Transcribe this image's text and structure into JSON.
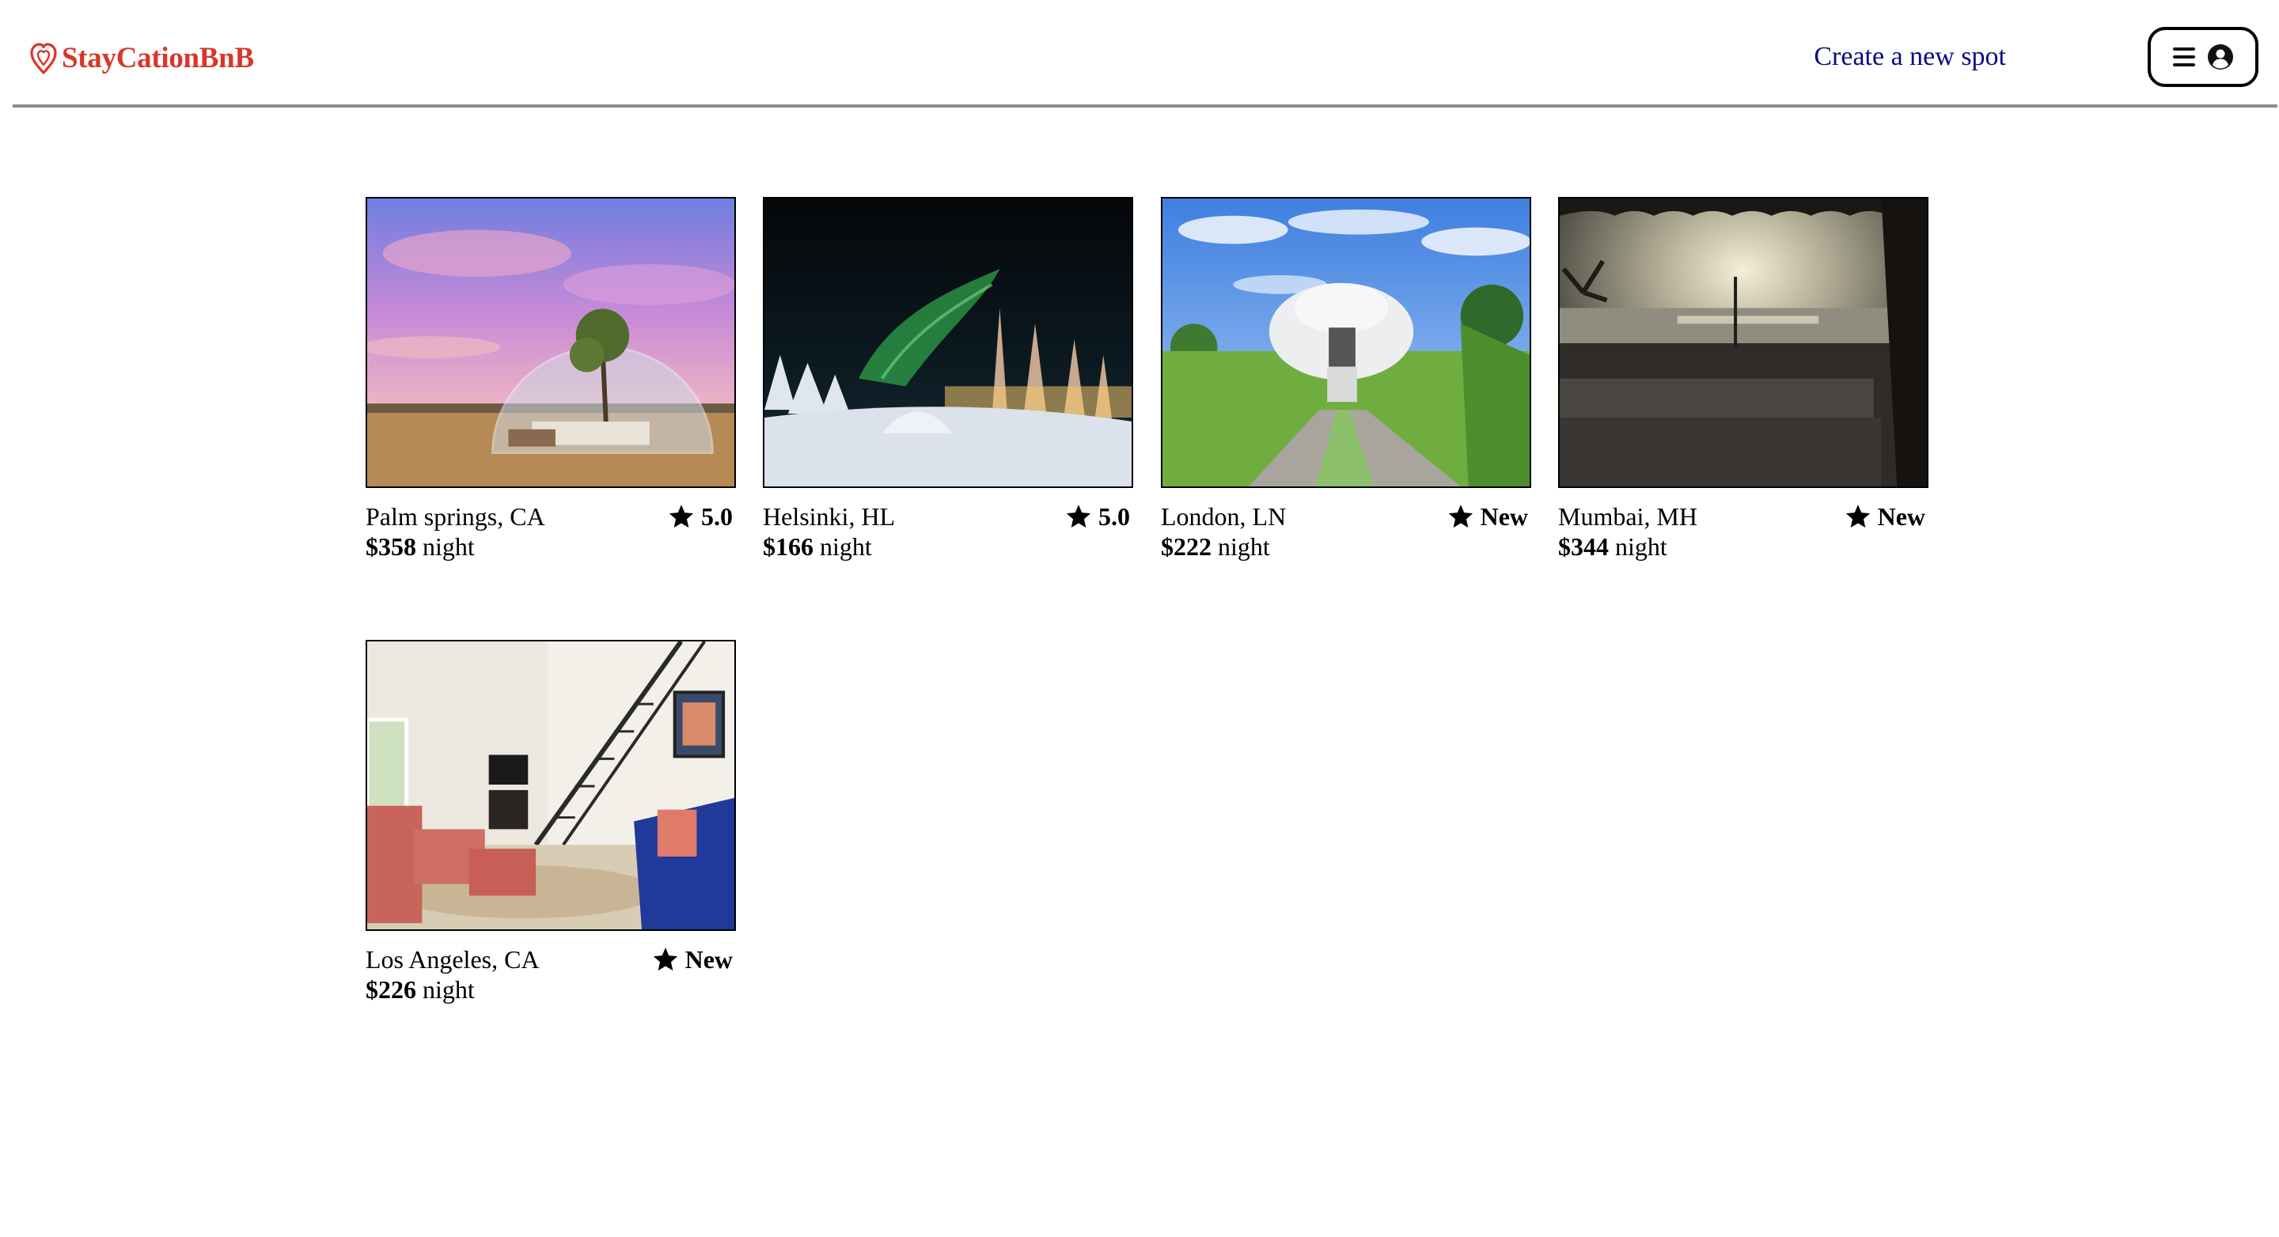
{
  "header": {
    "logo_text": "StayCationBnB",
    "create_link": "Create a new spot",
    "brand_color": "#d9362b"
  },
  "spots": [
    {
      "location": "Palm springs, CA",
      "rating": "5.0",
      "price": "$358",
      "unit": "night"
    },
    {
      "location": "Helsinki, HL",
      "rating": "5.0",
      "price": "$166",
      "unit": "night"
    },
    {
      "location": "London, LN",
      "rating": "New",
      "price": "$222",
      "unit": "night"
    },
    {
      "location": "Mumbai, MH",
      "rating": "New",
      "price": "$344",
      "unit": "night"
    },
    {
      "location": "Los Angeles, CA",
      "rating": "New",
      "price": "$226",
      "unit": "night"
    }
  ]
}
